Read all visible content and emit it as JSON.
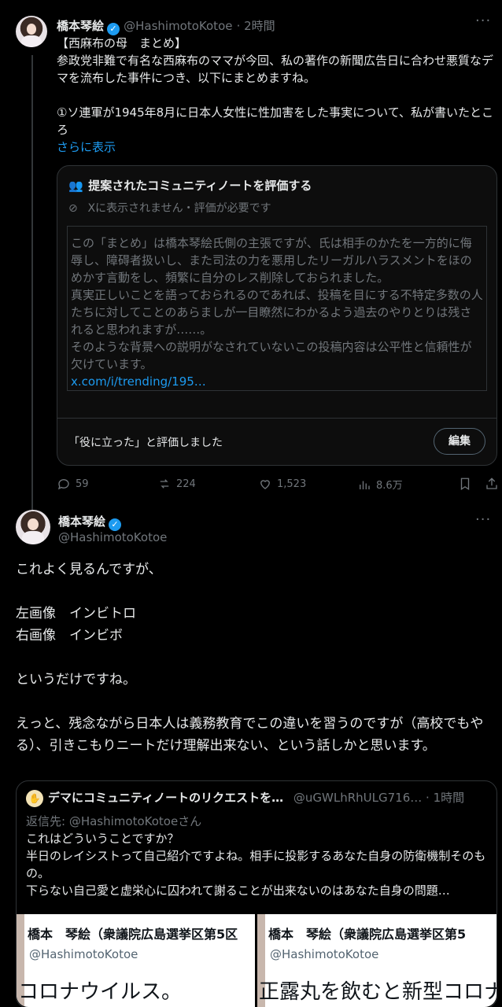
{
  "tweet1": {
    "name": "橋本琴絵",
    "handle": "@HashimotoKotoe",
    "time": "· 2時間",
    "text": "【西麻布の母　まとめ】\n参政党非難で有名な西麻布のママが今回、私の著作の新聞広告日に合わせ悪質なデマを流布した事件につき、以下にまとめますね。\n\n①ソ連軍が1945年8月に日本人女性に性加害をした事実について、私が書いたところ",
    "show_more": "さらに表示",
    "note": {
      "title": "提案されたコミュニティノートを評価する",
      "subtitle": "Xに表示されません・評価が必要です",
      "body": "この「まとめ」は橋本琴絵氏側の主張ですが、氏は相手のかたを一方的に侮辱し、障碍者扱いし、また司法の力を悪用したリーガルハラスメントをほのめかす言動をし、頻繁に自分のレス削除しておられました。\n真実正しいことを語っておられるのであれば、投稿を目にする不特定多数の人たちに対してことのあらましが一目瞭然にわかるよう過去のやりとりは残されると思われますが……。\nそのような背景への説明がなされていないこの投稿内容は公平性と信頼性が欠けています。",
      "link": "x.com/i/trending/195…",
      "footer": "「役に立った」と評価しました",
      "edit_label": "編集"
    },
    "stats": {
      "replies": "59",
      "reposts": "224",
      "likes": "1,523",
      "views": "8.6万"
    }
  },
  "tweet2": {
    "name": "橋本琴絵",
    "handle": "@HashimotoKotoe",
    "text": "これよく見るんですが、\n\n左画像　インビトロ\n右画像　インビボ\n\nというだけですね。\n\nえっと、残念ながら日本人は義務教育でこの違いを習うのですが（高校でもやる）、引きこもりニートだけ理解出来ない、という話しかと思います。",
    "quote": {
      "name": "デマにコミュニティノートのリクエストを…",
      "handle": "@uGWLhRhULG716…",
      "time": "· 1時間",
      "reply_to": "返信先: @HashimotoKotoeさん",
      "text": "これはどういうことですか？\n半日のレイシストって自己紹介ですよね。相手に投影するあなた自身の防衛機制そのもの。\n下らない自己愛と虚栄心に囚われて謝ることが出来ないのはあなた自身の問題…",
      "img_left": {
        "name": "橋本　琴絵（衆議院広島選挙区第5区",
        "handle": "@HashimotoKotoe",
        "big": "コロナウイルス。"
      },
      "img_right": {
        "name": "橋本　琴絵（衆議院広島選挙区第5",
        "handle": "@HashimotoKotoe",
        "big": "正露丸を飲むと新型コロナ"
      }
    }
  },
  "colors": {
    "accent": "#1d9bf0",
    "muted": "#71767b",
    "border": "#2f3336"
  }
}
